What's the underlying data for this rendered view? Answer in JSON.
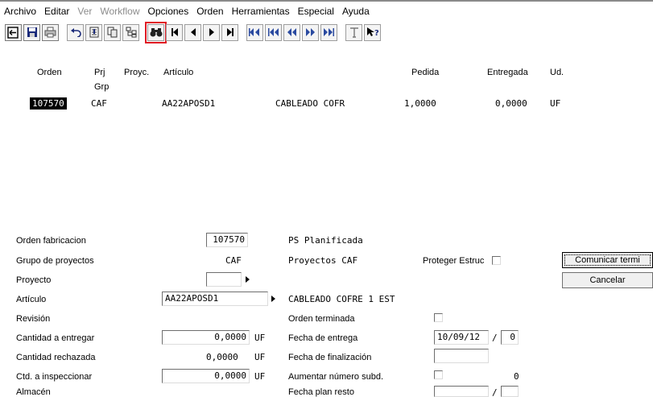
{
  "menu": [
    {
      "label": "Archivo",
      "disabled": false
    },
    {
      "label": "Editar",
      "disabled": false
    },
    {
      "label": "Ver",
      "disabled": true
    },
    {
      "label": "Workflow",
      "disabled": true
    },
    {
      "label": "Opciones",
      "disabled": false
    },
    {
      "label": "Orden",
      "disabled": false
    },
    {
      "label": "Herramientas",
      "disabled": false
    },
    {
      "label": "Especial",
      "disabled": false
    },
    {
      "label": "Ayuda",
      "disabled": false
    }
  ],
  "toolbar": {
    "icons": [
      "exit-icon",
      "save-icon",
      "print-icon",
      "undo-icon",
      "insert-row-icon",
      "copy-icon",
      "tree-icon",
      "find-icon",
      "first-icon",
      "prev-icon",
      "next-icon",
      "last-icon",
      "first-page-icon",
      "prev-page-icon",
      "rewind-icon",
      "forward-icon",
      "last-page-icon",
      "text-icon",
      "help-icon"
    ],
    "highlighted": "find-icon",
    "highlight_color": "#e01b24"
  },
  "grid": {
    "headers": {
      "orden": "Orden",
      "prj": "Prj",
      "grp": "Grp",
      "proyc": "Proyc.",
      "articulo": "Artículo",
      "pedida": "Pedida",
      "entregada": "Entregada",
      "ud": "Ud."
    },
    "rows": [
      {
        "orden": "107570",
        "prj": "CAF",
        "articulo": "AA22APOSD1",
        "descripcion": "CABLEADO COFR",
        "pedida": "1,0000",
        "entregada": "0,0000",
        "ud": "UF"
      }
    ]
  },
  "form": {
    "orden_fabricacion_label": "Orden fabricacion",
    "orden_fabricacion_value": "107570",
    "estado": "PS Planificada",
    "grupo_proyectos_label": "Grupo de proyectos",
    "grupo_proyectos_value": "CAF",
    "grupo_proyectos_desc": "Proyectos CAF",
    "proteger_estruc_label": "Proteger Estruc",
    "proyecto_label": "Proyecto",
    "proyecto_value": "",
    "articulo_label": "Artículo",
    "articulo_value": "AA22APOSD1",
    "articulo_desc": "CABLEADO COFRE 1 EST",
    "revision_label": "Revisión",
    "orden_terminada_label": "Orden terminada",
    "cantidad_entregar_label": "Cantidad a entregar",
    "cantidad_entregar_value": "0,0000",
    "cantidad_entregar_ud": "UF",
    "fecha_entrega_label": "Fecha de entrega",
    "fecha_entrega_value": "10/09/12",
    "fecha_entrega_slash": "/",
    "fecha_entrega_extra": "0",
    "cantidad_rechazada_label": "Cantidad rechazada",
    "cantidad_rechazada_value": "0,0000",
    "cantidad_rechazada_ud": "UF",
    "fecha_finalizacion_label": "Fecha de finalización",
    "fecha_finalizacion_value": "",
    "ctd_inspeccionar_label": "Ctd. a inspeccionar",
    "ctd_inspeccionar_value": "0,0000",
    "ctd_inspeccionar_ud": "UF",
    "aumentar_subd_label": "Aumentar número subd.",
    "aumentar_subd_value": "0",
    "almacen_label": "Almacén",
    "fecha_plan_resto_label": "Fecha plan resto",
    "fecha_plan_resto_slash": "/"
  },
  "buttons": {
    "comunicar": "Comunicar termi",
    "cancelar": "Cancelar"
  }
}
